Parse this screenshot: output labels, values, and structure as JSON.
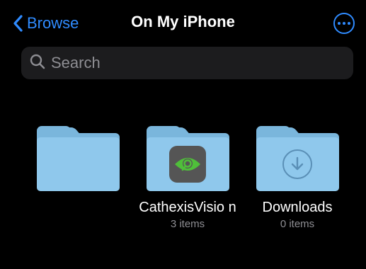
{
  "nav": {
    "back_label": "Browse",
    "title": "On My iPhone",
    "more_icon": "ellipsis-circle-icon"
  },
  "search": {
    "placeholder": "Search"
  },
  "folders": [
    {
      "name": "",
      "count": "",
      "icon": "folder-icon"
    },
    {
      "name": "CathexisVisio n",
      "count": "3 items",
      "icon": "cathexis-eye-icon"
    },
    {
      "name": "Downloads",
      "count": "0 items",
      "icon": "download-arrow-icon"
    }
  ],
  "colors": {
    "accent": "#2f8bff",
    "folder": "#8fc8ec",
    "secondary_text": "#8e8e93"
  }
}
